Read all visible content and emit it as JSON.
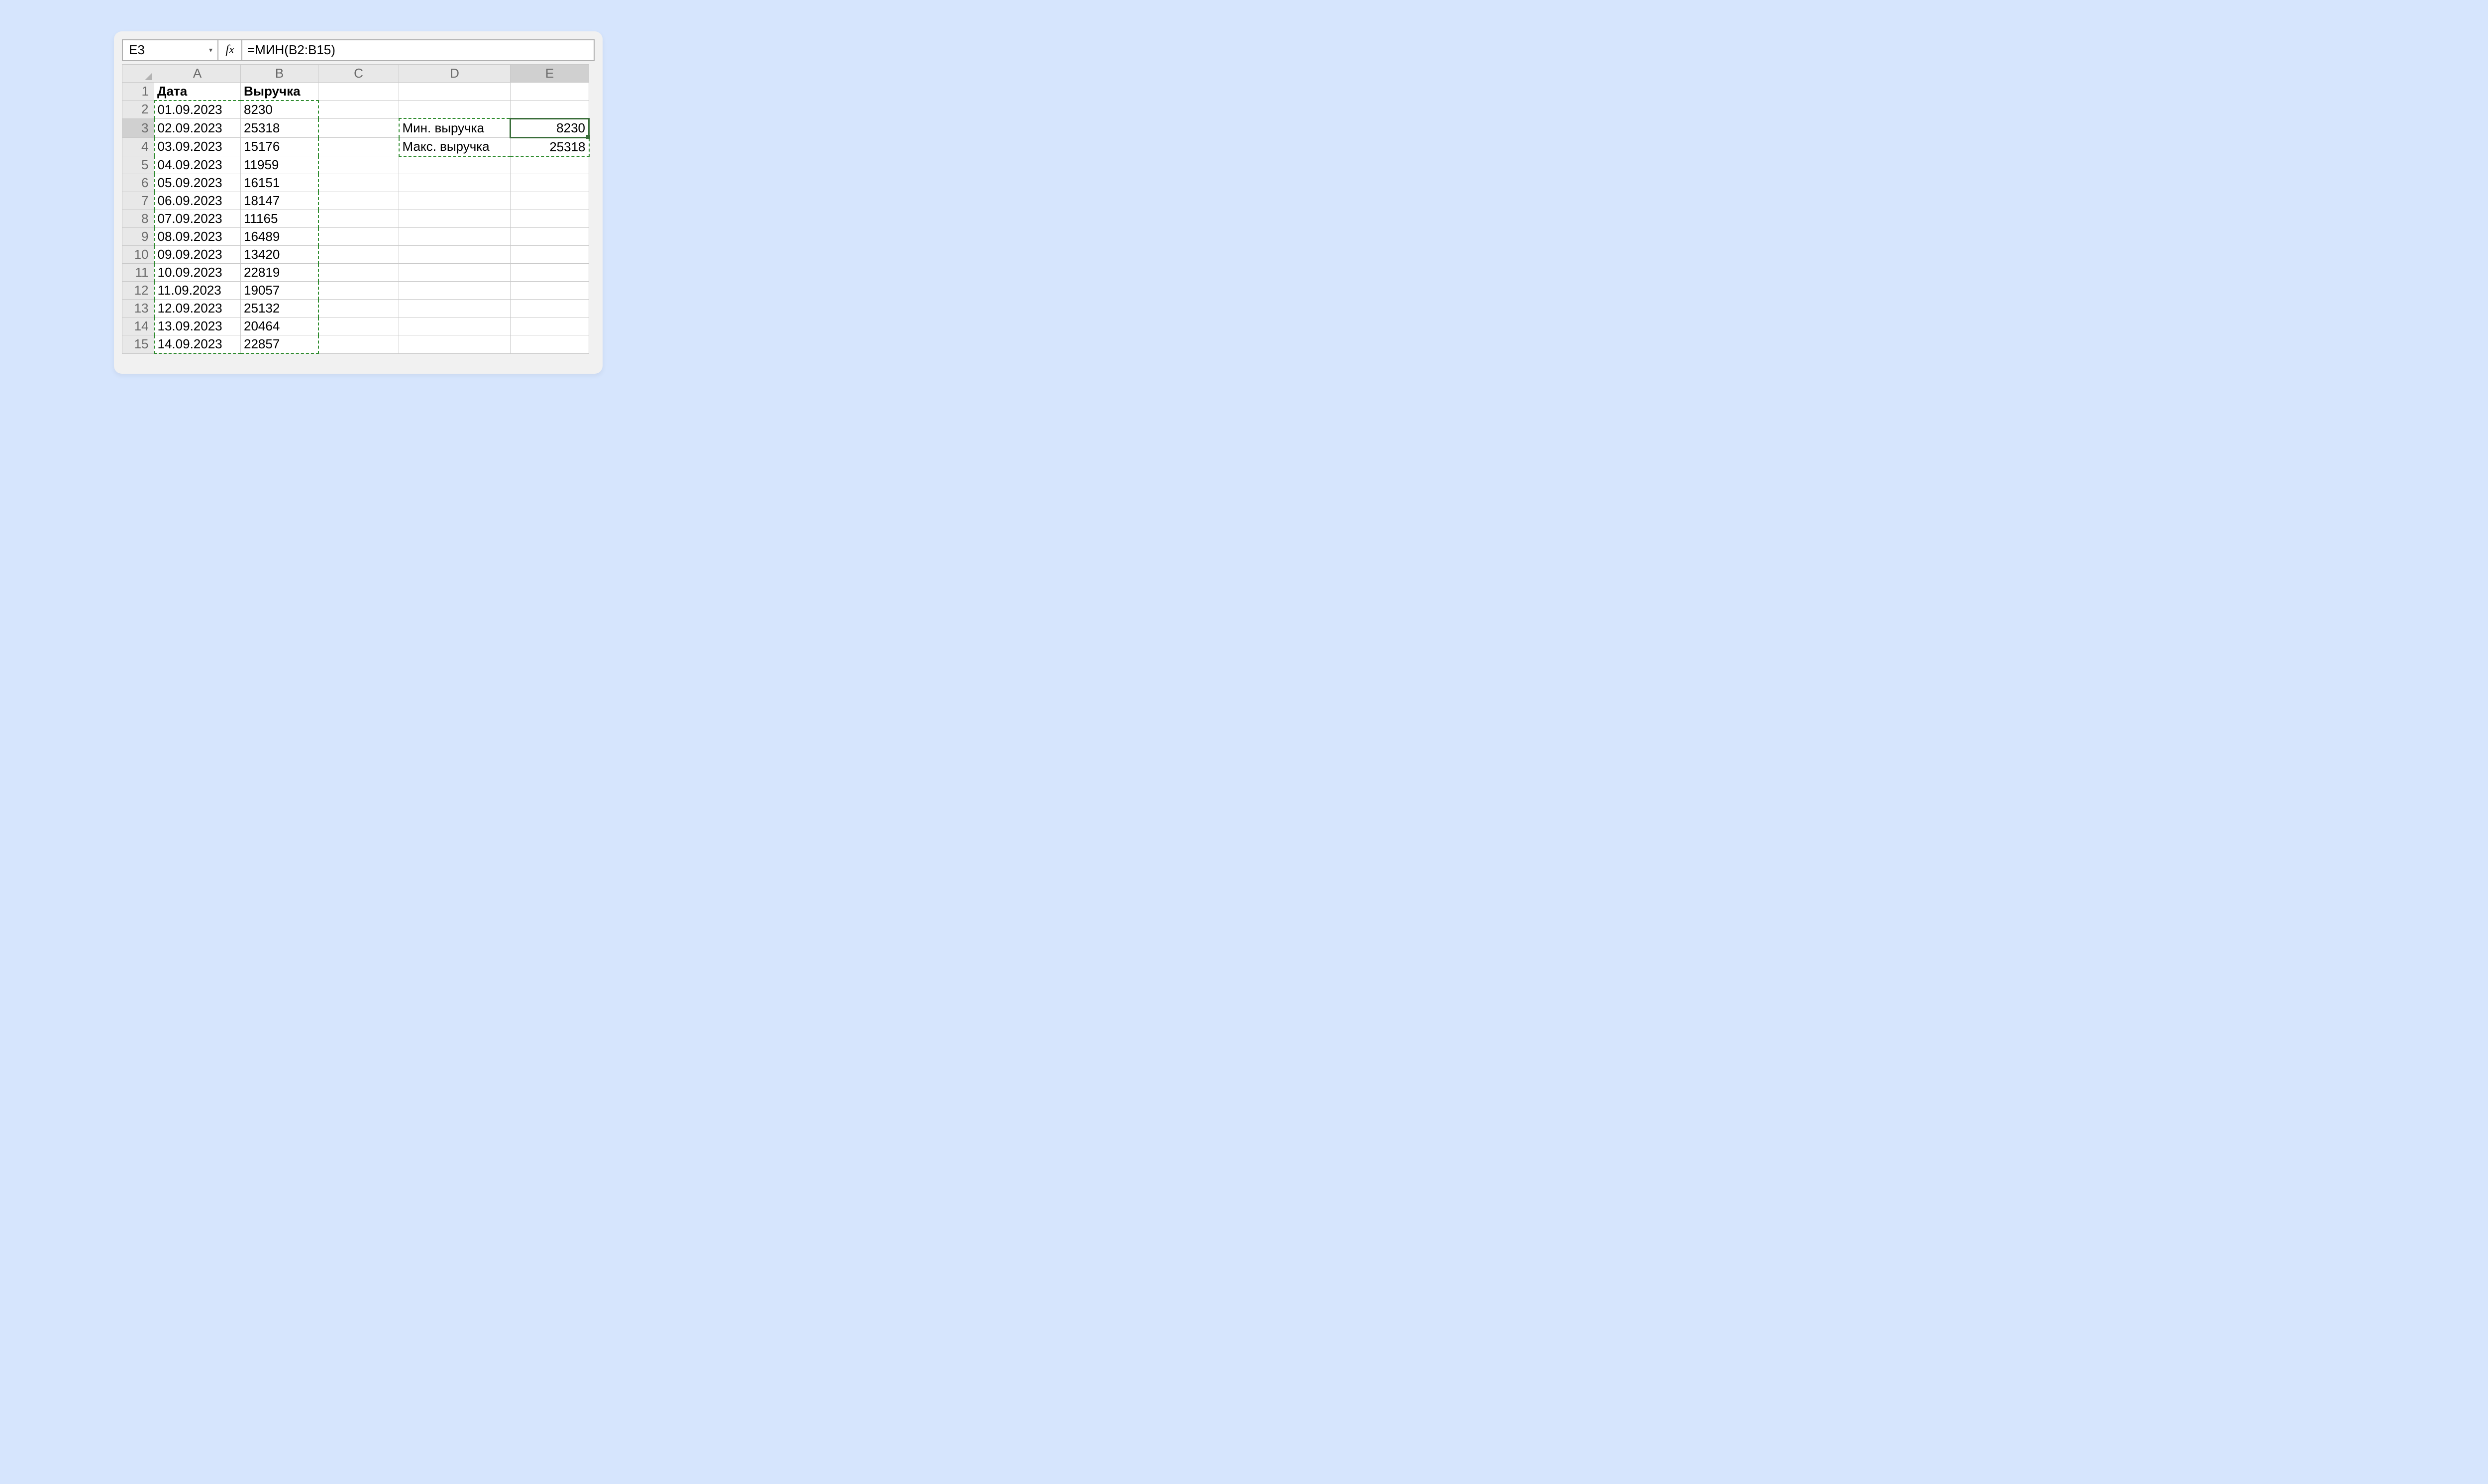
{
  "name_box": "E3",
  "fx_label": "fx",
  "formula": "=МИН(B2:B15)",
  "columns": [
    "A",
    "B",
    "C",
    "D",
    "E"
  ],
  "rows": [
    "1",
    "2",
    "3",
    "4",
    "5",
    "6",
    "7",
    "8",
    "9",
    "10",
    "11",
    "12",
    "13",
    "14",
    "15"
  ],
  "headers": {
    "A1": "Дата",
    "B1": "Выручка"
  },
  "data": {
    "A": [
      "01.09.2023",
      "02.09.2023",
      "03.09.2023",
      "04.09.2023",
      "05.09.2023",
      "06.09.2023",
      "07.09.2023",
      "08.09.2023",
      "09.09.2023",
      "10.09.2023",
      "11.09.2023",
      "12.09.2023",
      "13.09.2023",
      "14.09.2023"
    ],
    "B": [
      "8230",
      "25318",
      "15176",
      "11959",
      "16151",
      "18147",
      "11165",
      "16489",
      "13420",
      "22819",
      "19057",
      "25132",
      "20464",
      "22857"
    ]
  },
  "side": {
    "D3": "Мин. выручка",
    "D4": "Макс. выручка",
    "E3": "8230",
    "E4": "25318"
  }
}
